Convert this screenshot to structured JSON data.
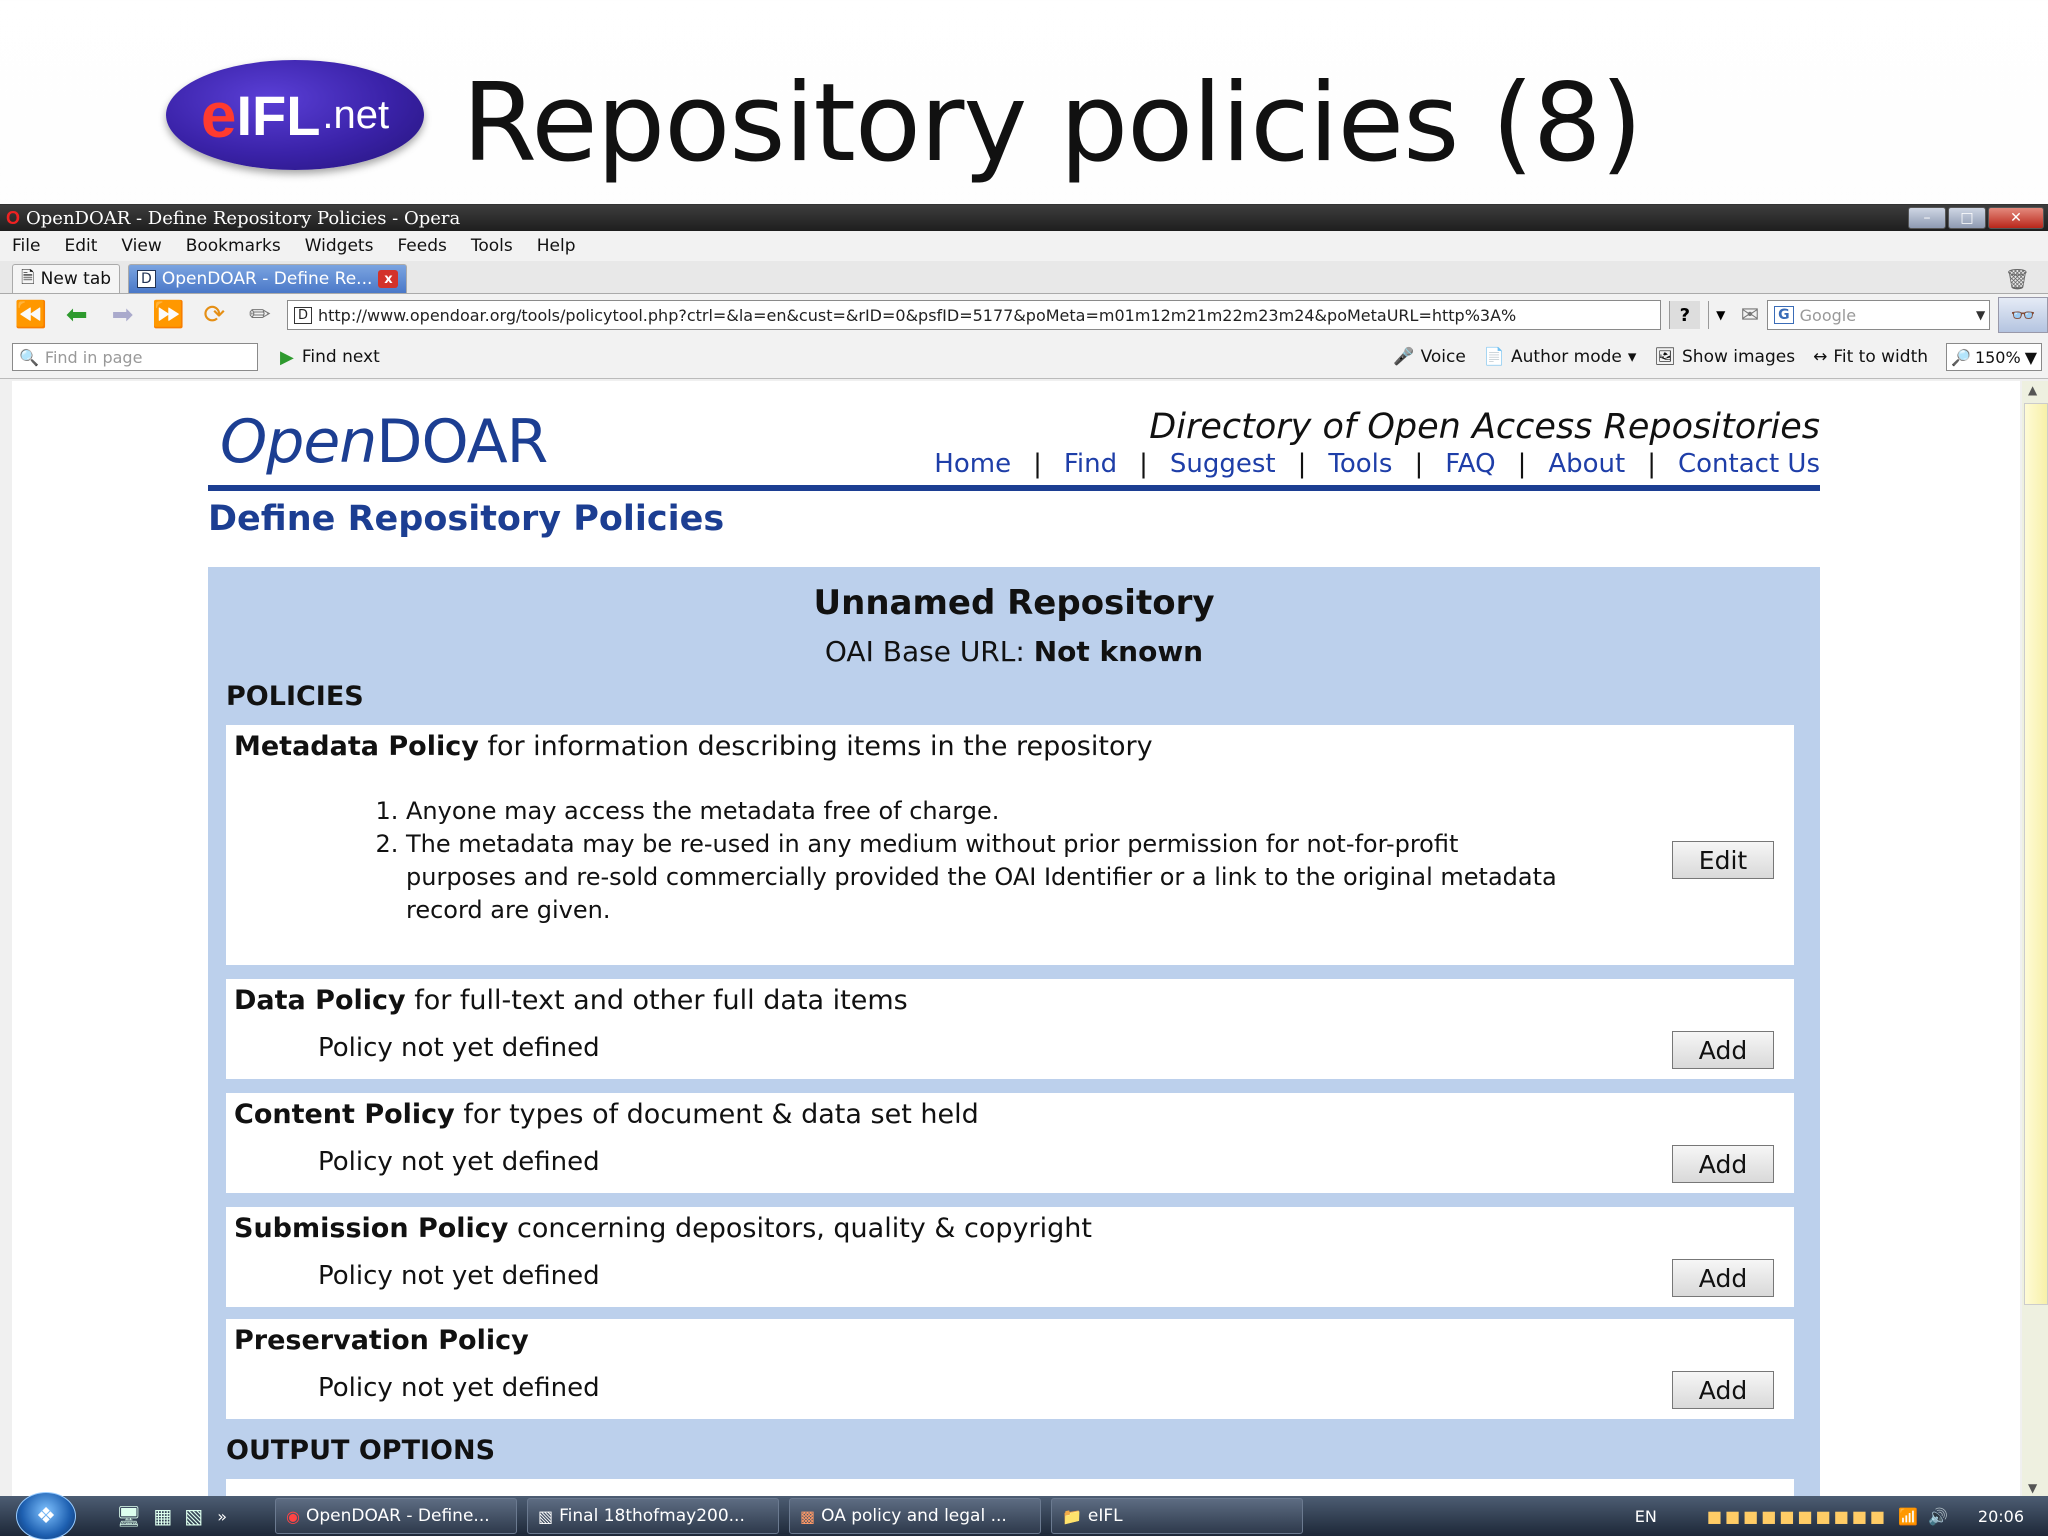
{
  "slide": {
    "logo_e": "e",
    "logo_ifl": "IFL",
    "logo_net": ".net",
    "title": "Repository policies (8)"
  },
  "window": {
    "title": "OpenDOAR - Define Repository Policies - Opera",
    "minimize": "–",
    "maximize": "□",
    "close": "✕"
  },
  "menu": [
    "File",
    "Edit",
    "View",
    "Bookmarks",
    "Widgets",
    "Feeds",
    "Tools",
    "Help"
  ],
  "tabs": {
    "new_tab": "New tab",
    "active": "OpenDOAR - Define Re...",
    "active_doc_icon": "D",
    "close_icon": "x"
  },
  "address": {
    "url": "http://www.opendoar.org/tools/policytool.php?ctrl=&la=en&cust=&rID=0&psfID=5177&poMeta=m01m12m21m22m23m24&poMetaURL=http%3A%",
    "page_icon": "D",
    "help": "?",
    "search_placeholder": "Google",
    "search_icon": "G"
  },
  "findbar": {
    "placeholder": "Find in page",
    "find_next": "Find next",
    "voice": "Voice",
    "author_mode": "Author mode",
    "show_images": "Show images",
    "fit_to_width": "Fit to width",
    "zoom": "150%"
  },
  "site": {
    "logo_open": "Open",
    "logo_doar": "DOAR",
    "tagline": "Directory of Open Access Repositories",
    "nav": [
      "Home",
      "Find",
      "Suggest",
      "Tools",
      "FAQ",
      "About",
      "Contact Us"
    ],
    "page_title": "Define Repository Policies"
  },
  "repository": {
    "name": "Unnamed Repository",
    "oai_label": "OAI Base URL:",
    "oai_value": "Not known"
  },
  "sections": {
    "policies": "POLICIES",
    "output_options": "OUTPUT OPTIONS"
  },
  "policies": [
    {
      "name": "Metadata Policy",
      "desc": "for information describing items in the repository",
      "items": [
        "Anyone may access the metadata free of charge.",
        "The metadata may be re-used in any medium without prior permission for not-for-profit purposes and re-sold commercially provided the OAI Identifier or a link to the original metadata record are given."
      ],
      "button": "Edit"
    },
    {
      "name": "Data Policy",
      "desc": "for full-text and other full data items",
      "status": "Policy not yet defined",
      "button": "Add"
    },
    {
      "name": "Content Policy",
      "desc": "for types of document & data set held",
      "status": "Policy not yet defined",
      "button": "Add"
    },
    {
      "name": "Submission Policy",
      "desc": "concerning depositors, quality & copyright",
      "status": "Policy not yet defined",
      "button": "Add"
    },
    {
      "name": "Preservation Policy",
      "desc": "",
      "status": "Policy not yet defined",
      "button": "Add"
    }
  ],
  "taskbar": {
    "more": "»",
    "tasks": [
      "OpenDOAR - Define...",
      "Final 18thofmay200...",
      "OA policy and legal ...",
      "eIFL"
    ],
    "lang": "EN",
    "clock": "20:06"
  }
}
